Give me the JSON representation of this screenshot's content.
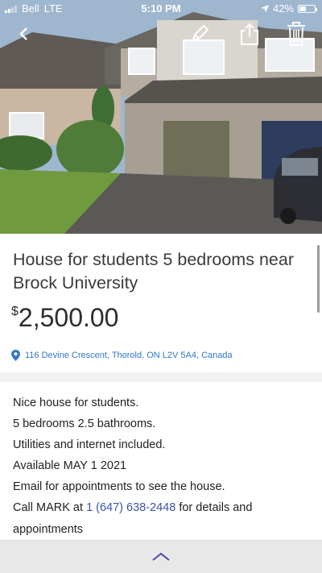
{
  "status_bar": {
    "carrier": "Bell",
    "network": "LTE",
    "time": "5:10 PM",
    "battery": "42%",
    "battery_level": 0.42
  },
  "toolbar": {
    "icons": [
      "back-chevron-icon",
      "edit-pencil-icon",
      "share-icon",
      "trash-icon"
    ]
  },
  "listing": {
    "title_line1": "House for students 5 bedrooms near",
    "title_line2": "Brock University",
    "currency_symbol": "$",
    "price": "2,500.00",
    "address": "116 Devine Crescent, Thorold, ON L2V 5A4, Canada"
  },
  "description": {
    "line1": "Nice house for students.",
    "line2": "5 bedrooms 2.5 bathrooms.",
    "line3": "Utilities and internet included.",
    "line4": "Available MAY 1 2021",
    "line5": "Email for appointments to see the house.",
    "line6_pre": "Call MARK at ",
    "phone": "1 (647) 638-2448",
    "line6_post": " for details and",
    "line7": "appointments"
  },
  "colors": {
    "link": "#2f78c9",
    "phone_link": "#3b55a8",
    "chevron": "#4a4aa8"
  }
}
